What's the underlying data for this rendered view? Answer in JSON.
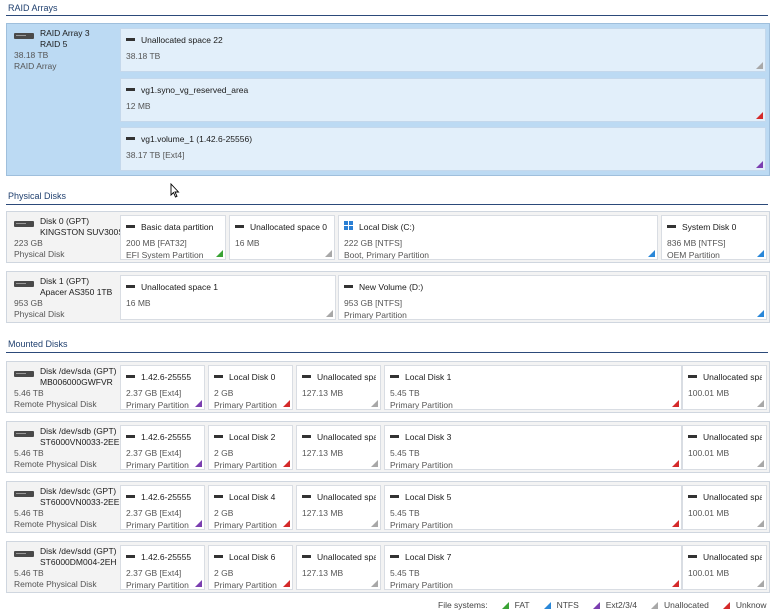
{
  "sections": {
    "raid": "RAID Arrays",
    "physical": "Physical Disks",
    "mounted": "Mounted Disks"
  },
  "raid": {
    "name": "RAID Array 3",
    "level": "RAID 5",
    "size": "38.18 TB",
    "type": "RAID Array",
    "partitions": [
      {
        "name": "Unallocated space 22",
        "size": "38.18 TB",
        "type": "",
        "fs": "unalloc"
      },
      {
        "name": "vg1.syno_vg_reserved_area",
        "size": "12 MB",
        "type": "",
        "fs": "unknown"
      },
      {
        "name": "vg1.volume_1 (1.42.6-25556)",
        "size": "38.17 TB [Ext4]",
        "type": "",
        "fs": "ext"
      }
    ]
  },
  "physical_disks": [
    {
      "name": "Disk 0 (GPT)",
      "model": "KINGSTON SUV300S",
      "size": "223 GB",
      "type": "Physical Disk",
      "partitions": [
        {
          "name": "Basic data partition",
          "size": "200 MB [FAT32]",
          "type": "EFI System Partition",
          "fs": "fat"
        },
        {
          "name": "Unallocated space 0",
          "size": "16 MB",
          "type": "",
          "fs": "unalloc"
        },
        {
          "name": "Local Disk (C:)",
          "size": "222 GB [NTFS]",
          "type": "Boot, Primary Partition",
          "fs": "ntfs"
        },
        {
          "name": "System Disk 0",
          "size": "836 MB [NTFS]",
          "type": "OEM Partition",
          "fs": "ntfs"
        }
      ]
    },
    {
      "name": "Disk 1 (GPT)",
      "model": "Apacer AS350 1TB",
      "size": "953 GB",
      "type": "Physical Disk",
      "partitions": [
        {
          "name": "Unallocated space 1",
          "size": "16 MB",
          "type": "",
          "fs": "unalloc"
        },
        {
          "name": "New Volume (D:)",
          "size": "953 GB [NTFS]",
          "type": "Primary Partition",
          "fs": "ntfs"
        }
      ]
    }
  ],
  "mounted_disks": [
    {
      "name": "Disk /dev/sda (GPT)",
      "model": "MB006000GWFVR",
      "size": "5.46 TB",
      "type": "Remote Physical Disk",
      "partitions": [
        {
          "name": "1.42.6-25555",
          "size": "2.37 GB [Ext4]",
          "type": "Primary Partition",
          "fs": "ext"
        },
        {
          "name": "Local Disk 0",
          "size": "2 GB",
          "type": "Primary Partition",
          "fs": "unknown"
        },
        {
          "name": "Unallocated spa",
          "size": "127.13 MB",
          "type": "",
          "fs": "unalloc"
        },
        {
          "name": "Local Disk 1",
          "size": "5.45 TB",
          "type": "Primary Partition",
          "fs": "unknown"
        },
        {
          "name": "Unallocated spa",
          "size": "100.01 MB",
          "type": "",
          "fs": "unalloc"
        }
      ]
    },
    {
      "name": "Disk /dev/sdb (GPT)",
      "model": "ST6000VN0033-2EE",
      "size": "5.46 TB",
      "type": "Remote Physical Disk",
      "partitions": [
        {
          "name": "1.42.6-25555",
          "size": "2.37 GB [Ext4]",
          "type": "Primary Partition",
          "fs": "ext"
        },
        {
          "name": "Local Disk 2",
          "size": "2 GB",
          "type": "Primary Partition",
          "fs": "unknown"
        },
        {
          "name": "Unallocated spa",
          "size": "127.13 MB",
          "type": "",
          "fs": "unalloc"
        },
        {
          "name": "Local Disk 3",
          "size": "5.45 TB",
          "type": "Primary Partition",
          "fs": "unknown"
        },
        {
          "name": "Unallocated spa",
          "size": "100.01 MB",
          "type": "",
          "fs": "unalloc"
        }
      ]
    },
    {
      "name": "Disk /dev/sdc (GPT)",
      "model": "ST6000VN0033-2EE",
      "size": "5.46 TB",
      "type": "Remote Physical Disk",
      "partitions": [
        {
          "name": "1.42.6-25555",
          "size": "2.37 GB [Ext4]",
          "type": "Primary Partition",
          "fs": "ext"
        },
        {
          "name": "Local Disk 4",
          "size": "2 GB",
          "type": "Primary Partition",
          "fs": "unknown"
        },
        {
          "name": "Unallocated spa",
          "size": "127.13 MB",
          "type": "",
          "fs": "unalloc"
        },
        {
          "name": "Local Disk 5",
          "size": "5.45 TB",
          "type": "Primary Partition",
          "fs": "unknown"
        },
        {
          "name": "Unallocated spa",
          "size": "100.01 MB",
          "type": "",
          "fs": "unalloc"
        }
      ]
    },
    {
      "name": "Disk /dev/sdd (GPT)",
      "model": "ST6000DM004-2EH",
      "size": "5.46 TB",
      "type": "Remote Physical Disk",
      "partitions": [
        {
          "name": "1.42.6-25555",
          "size": "2.37 GB [Ext4]",
          "type": "Primary Partition",
          "fs": "ext"
        },
        {
          "name": "Local Disk 6",
          "size": "2 GB",
          "type": "Primary Partition",
          "fs": "unknown"
        },
        {
          "name": "Unallocated spa",
          "size": "127.13 MB",
          "type": "",
          "fs": "unalloc"
        },
        {
          "name": "Local Disk 7",
          "size": "5.45 TB",
          "type": "Primary Partition",
          "fs": "unknown"
        },
        {
          "name": "Unallocated spa",
          "size": "100.01 MB",
          "type": "",
          "fs": "unalloc"
        }
      ]
    }
  ],
  "legend": {
    "label": "File systems:",
    "fat": "FAT",
    "ntfs": "NTFS",
    "ext": "Ext2/3/4",
    "unalloc": "Unallocated",
    "unknown": "Unknow"
  },
  "colors": {
    "fat": "#3aa335",
    "ntfs": "#2a87d8",
    "ext": "#7b3fb0",
    "unalloc": "#a8a8a8",
    "unknown": "#d42a2a"
  }
}
